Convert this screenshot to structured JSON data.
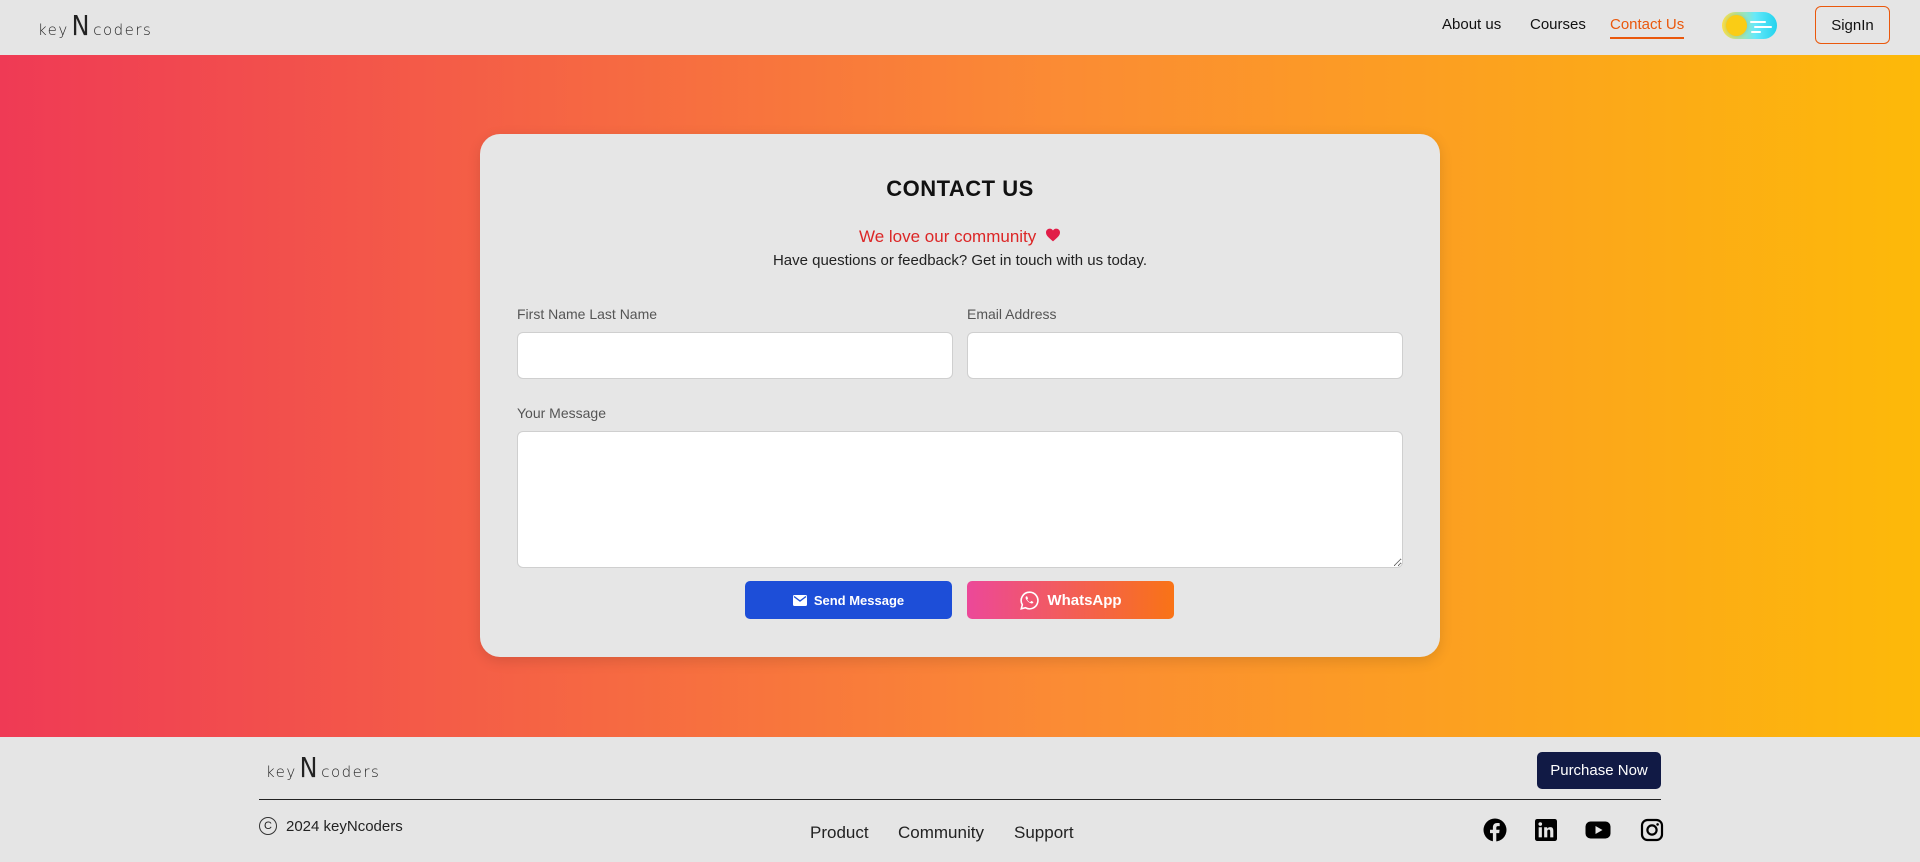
{
  "brand": {
    "logo_left": "key",
    "logo_mid": "N",
    "logo_right": "coders"
  },
  "nav": {
    "items": [
      {
        "label": "About us",
        "active": false
      },
      {
        "label": "Courses",
        "active": false
      },
      {
        "label": "Contact Us",
        "active": true
      }
    ],
    "signin_label": "SignIn",
    "theme_toggle_icon": "theme-toggle-icon"
  },
  "colors": {
    "accent": "#ea580c",
    "gradient_start": "#ef3a55",
    "gradient_end": "#fdb909",
    "send_button": "#1d4ed8",
    "purchase_button": "#111a45",
    "tagline": "#dc2626"
  },
  "contact": {
    "title": "CONTACT US",
    "tagline": "We love our community",
    "tagline_icon": "heart-icon",
    "subtitle": "Have questions or feedback? Get in touch with us today.",
    "name_label": "First Name Last Name",
    "name_value": "",
    "email_label": "Email Address",
    "email_value": "",
    "message_label": "Your Message",
    "message_value": "",
    "send_label": "Send Message",
    "send_icon": "mail-icon",
    "whatsapp_label": "WhatsApp",
    "whatsapp_icon": "whatsapp-icon"
  },
  "footer": {
    "purchase_label": "Purchase Now",
    "copyright_icon": "copyright-icon",
    "copyright_text": "2024 keyNcoders",
    "links": [
      "Product",
      "Community",
      "Support"
    ],
    "social_icons": [
      "facebook-icon",
      "linkedin-icon",
      "youtube-icon",
      "instagram-icon"
    ]
  }
}
